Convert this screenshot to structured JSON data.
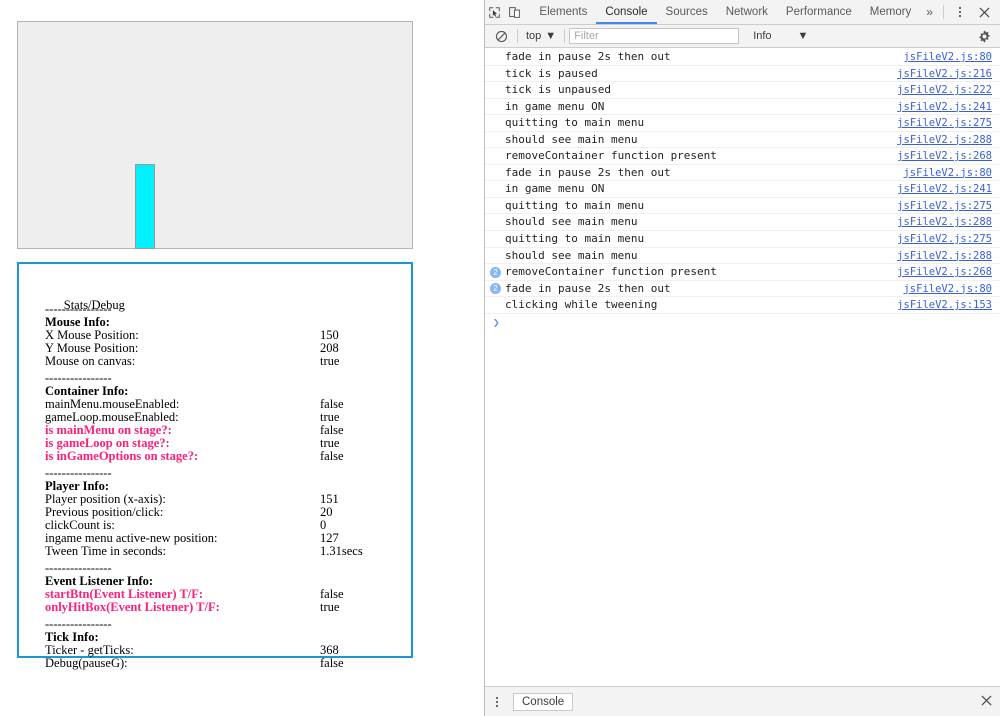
{
  "page": {
    "canvas": {
      "name": "game-canvas",
      "background": "#eeeeee",
      "border_color": "#b4b4b4",
      "player_color": "#00f0ff"
    },
    "stats": {
      "title": "Stats/Debug",
      "divider": "----------------",
      "sections": [
        {
          "heading": "Mouse Info:",
          "rows": [
            {
              "label": "X Mouse Position:",
              "value": "150",
              "pink": false
            },
            {
              "label": "Y Mouse Position:",
              "value": "208",
              "pink": false
            },
            {
              "label": "Mouse on canvas:",
              "value": "true",
              "pink": false
            }
          ]
        },
        {
          "heading": "Container Info:",
          "rows": [
            {
              "label": "mainMenu.mouseEnabled:",
              "value": "false",
              "pink": false
            },
            {
              "label": "gameLoop.mouseEnabled:",
              "value": "true",
              "pink": false
            },
            {
              "label": "is mainMenu on stage?:",
              "value": "false",
              "pink": true
            },
            {
              "label": "is gameLoop on stage?:",
              "value": "true",
              "pink": true
            },
            {
              "label": "is inGameOptions on stage?:",
              "value": "false",
              "pink": true
            }
          ]
        },
        {
          "heading": "Player Info:",
          "rows": [
            {
              "label": "Player position (x-axis):",
              "value": "151",
              "pink": false
            },
            {
              "label": "Previous position/click:",
              "value": "20",
              "pink": false
            },
            {
              "label": "clickCount is:",
              "value": "0",
              "pink": false
            },
            {
              "label": "ingame menu active-new position:",
              "value": "127",
              "pink": false
            },
            {
              "label": "Tween Time in seconds:",
              "value": "1.31secs",
              "pink": false
            }
          ]
        },
        {
          "heading": "Event Listener Info:",
          "rows": [
            {
              "label": "startBtn(Event Listener) T/F:",
              "value": "false",
              "pink": true
            },
            {
              "label": "onlyHitBox(Event Listener) T/F:",
              "value": "true",
              "pink": true
            }
          ]
        },
        {
          "heading": "Tick Info:",
          "rows": [
            {
              "label": "Ticker - getTicks:",
              "value": "368",
              "pink": false
            },
            {
              "label": "Debug(pauseG):",
              "value": "false",
              "pink": false
            }
          ]
        }
      ]
    }
  },
  "devtools": {
    "toolbar": {
      "inspect_icon": "inspect-element-icon",
      "device_icon": "device-toolbar-icon",
      "tabs": [
        {
          "label": "Elements",
          "active": false
        },
        {
          "label": "Console",
          "active": true
        },
        {
          "label": "Sources",
          "active": false
        },
        {
          "label": "Network",
          "active": false
        },
        {
          "label": "Performance",
          "active": false
        },
        {
          "label": "Memory",
          "active": false
        }
      ],
      "more_tabs": "»",
      "menu_icon": "more-options-icon",
      "close_icon": "close-icon"
    },
    "filterbar": {
      "clear_icon": "clear-console-icon",
      "context": "top",
      "filter_placeholder": "Filter",
      "filter_value": "",
      "level": "Info",
      "settings_icon": "gear-icon"
    },
    "console": {
      "prompt": "❯",
      "messages": [
        {
          "count": "",
          "text": "fade in pause 2s then out",
          "source": "jsFileV2.js:80"
        },
        {
          "count": "",
          "text": "tick is paused",
          "source": "jsFileV2.js:216"
        },
        {
          "count": "",
          "text": "tick is unpaused",
          "source": "jsFileV2.js:222"
        },
        {
          "count": "",
          "text": "in game menu ON",
          "source": "jsFileV2.js:241"
        },
        {
          "count": "",
          "text": "quitting to main menu",
          "source": "jsFileV2.js:275"
        },
        {
          "count": "",
          "text": "should see main menu",
          "source": "jsFileV2.js:288"
        },
        {
          "count": "",
          "text": "removeContainer function present",
          "source": "jsFileV2.js:268"
        },
        {
          "count": "",
          "text": "fade in pause 2s then out",
          "source": "jsFileV2.js:80"
        },
        {
          "count": "",
          "text": "in game menu ON",
          "source": "jsFileV2.js:241"
        },
        {
          "count": "",
          "text": "quitting to main menu",
          "source": "jsFileV2.js:275"
        },
        {
          "count": "",
          "text": "should see main menu",
          "source": "jsFileV2.js:288"
        },
        {
          "count": "",
          "text": "quitting to main menu",
          "source": "jsFileV2.js:275"
        },
        {
          "count": "",
          "text": "should see main menu",
          "source": "jsFileV2.js:288"
        },
        {
          "count": "2",
          "text": "removeContainer function present",
          "source": "jsFileV2.js:268"
        },
        {
          "count": "2",
          "text": "fade in pause 2s then out",
          "source": "jsFileV2.js:80"
        },
        {
          "count": "",
          "text": "clicking while tweening",
          "source": "jsFileV2.js:153"
        }
      ]
    },
    "drawer": {
      "menu_icon": "drawer-menu-icon",
      "tab": "Console",
      "close_icon": "close-drawer-icon"
    }
  }
}
